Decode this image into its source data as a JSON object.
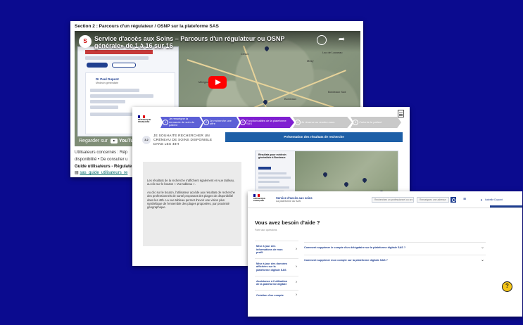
{
  "colors": {
    "background": "#0b0b8f",
    "step_done": "#5c5fd6",
    "step_active": "#7f1fd1",
    "step_todo": "#c9c9c9",
    "banner_blue": "#1d5fa7",
    "help_yellow": "#f5c518"
  },
  "video_card": {
    "section_title": "Section 2 : Parcours d'un régulateur / OSNP sur la plateforme SAS",
    "video_title": "Service d'accès aux Soins – Parcours d'un régulateur ou OSNP générale» de 1 à 16 sur 16",
    "watch_on": "Regarder sur",
    "youtube_label": "YouTube",
    "description_line1": "Utilisateurs concernés : Rép",
    "description_line2": "disponibilité • De consulter u",
    "guide_title": "Guide utilisateurs - Régulate",
    "guide_link": "sas_guide_utilisateurs_re",
    "app_panel": {
      "doctor_name": "Dr Paul Dupont",
      "doctor_specialty": "Médecin généraliste",
      "tab1": "Disponible",
      "tab2": "Sans rendez-vous"
    },
    "map_labels": [
      "Mézy",
      "Lac de Lacanau",
      "Cesso",
      "Bordeaux",
      "Bordeaux Sud",
      "Pessac",
      "Mérignac"
    ],
    "icons": [
      "clock-icon",
      "share-icon",
      "play-icon",
      "youtube-logo"
    ]
  },
  "results_card": {
    "steps": [
      {
        "num": "1",
        "label": "Je renseigne la demande de soin du patient",
        "state": "done"
      },
      {
        "num": "2",
        "label": "Je recherche une offre",
        "state": "done"
      },
      {
        "num": "3",
        "label": "Fonctionnalités de la plateforme SAS",
        "state": "active"
      },
      {
        "num": "4",
        "label": "Je réserve un rendez-vous",
        "state": "todo"
      },
      {
        "num": "5",
        "label": "J'oriente le patient",
        "state": "todo"
      }
    ],
    "section_number": "3.2",
    "question": "JE SOUHAITE RECHERCHER UN CRÉNEAU DE SOINS DISPONIBLE DANS LES 48H",
    "banner": "Présentation des résultats de recherche",
    "info_paragraph1": "Les résultats de la recherche s'affichent également en vue tableau, au clic sur le bouton « Vue tableau ».",
    "info_paragraph2": "Au clic sur le bouton, l'utilisateur accède aux résultats de recherche des professionnels de santé proposant des plages de disponibilité dans les 48h. La vue tableau permet d'avoir une vision plus synthétique de l'ensemble des plages proposées, par proximité géographique.",
    "shot_title": "Résultats pour médecin généraliste à Bordeaux"
  },
  "help_card": {
    "republic": "RÉPUBLIQUE FRANÇAISE",
    "service_name": "Service d'accès aux soins",
    "service_sub": "La plateforme du SAS",
    "search_placeholder": "Recherchez un professionnel ou un service...",
    "location_placeholder": "Renseignez une adresse",
    "user_label": "Isabelle Dupont",
    "title": "Vous avez besoin d'aide ?",
    "subtitle": "Foire aux questions",
    "side_items": [
      "Mise à jour des informations de mon profil",
      "Mise à jour des données affichées sur la plateforme digitale SAS",
      "Assistance à l'utilisation de la plateforme digitale",
      "Création d'un compte"
    ],
    "faq_items": [
      "Comment supprimer le compte d'un délégataire sur la plateforme digitale SAS ?",
      "Comment supprimer mon compte sur la plateforme digitale SAS ?"
    ],
    "help_button": "?"
  }
}
